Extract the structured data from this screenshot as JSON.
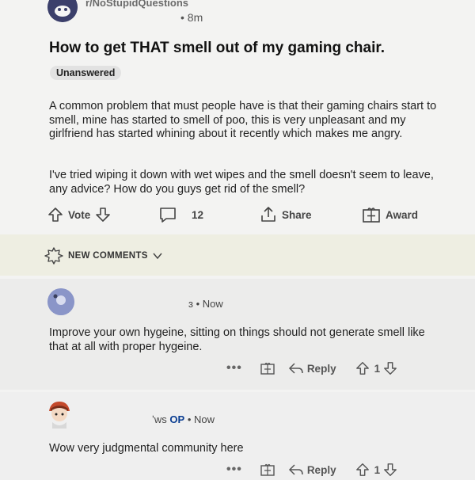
{
  "post": {
    "subreddit": "r/NoStupidQuestions",
    "time": "• 8m",
    "title": "How to get THAT smell out of my gaming chair.",
    "flair": "Unanswered",
    "paragraph1": "A common problem that must people have is that their gaming chairs start to smell, mine has started to smell of poo, this is very unpleasant and my girlfriend has started whining about it recently which makes me angry.",
    "paragraph2": "I've tried wiping it down with wet wipes and the smell doesn't seem to leave, any advice? How do you guys get rid of the smell?",
    "actions": {
      "vote_label": "Vote",
      "comment_count": "12",
      "share_label": "Share",
      "award_label": "Award"
    }
  },
  "new_comments": {
    "label": "NEW COMMENTS"
  },
  "comments": [
    {
      "meta": "ɜ • Now",
      "text": "Improve your own hygeine, sitting on things should not generate smell like that at all with proper hygeine.",
      "more": "•••",
      "reply_label": "Reply",
      "score": "1"
    },
    {
      "meta_prefix": "ʼws",
      "op_badge": "OP",
      "meta_time": "• Now",
      "text": "Wow very judgmental community here",
      "more": "•••",
      "reply_label": "Reply",
      "score": "1"
    }
  ],
  "icons": {
    "upvote": "upvote-arrow-icon",
    "downvote": "downvote-arrow-icon",
    "comment": "comment-bubble-icon",
    "share": "share-icon",
    "award": "award-gift-icon",
    "new_comments": "sparkle-badge-icon",
    "chevron": "chevron-down-icon",
    "reply": "reply-arrow-icon"
  },
  "colors": {
    "op_badge": "#0a3d91",
    "avatar1": "#8a95c8",
    "highlight_band": "#eeeee2"
  }
}
